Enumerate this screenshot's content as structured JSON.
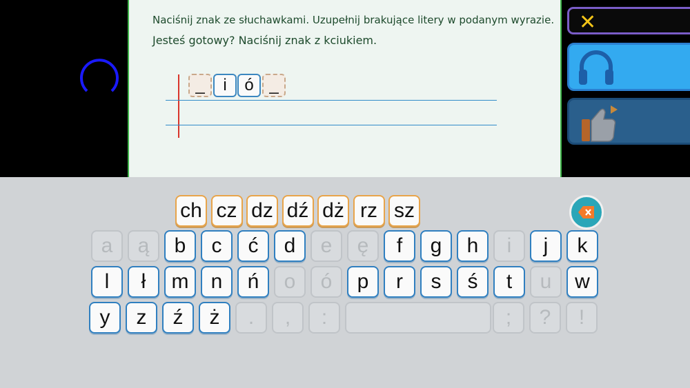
{
  "instructions": {
    "line1": "Naciśnij znak ze słuchawkami. Uzupełnij brakujące litery w podanym wyrazie.",
    "line2": "Jesteś gotowy? Naciśnij znak z kciukiem."
  },
  "word_slots": [
    {
      "value": "_",
      "state": "blank"
    },
    {
      "value": "i",
      "state": "filled"
    },
    {
      "value": "ó",
      "state": "filled"
    },
    {
      "value": "_",
      "state": "blank"
    }
  ],
  "side_buttons": {
    "close_icon": "close-icon",
    "audio_icon": "headphones-icon",
    "confirm_icon": "thumbs-up-icon"
  },
  "keyboard": {
    "digraphs": [
      "ch",
      "cz",
      "dz",
      "dź",
      "dż",
      "rz",
      "sz"
    ],
    "row1": [
      {
        "k": "a",
        "on": false
      },
      {
        "k": "ą",
        "on": false
      },
      {
        "k": "b",
        "on": true
      },
      {
        "k": "c",
        "on": true
      },
      {
        "k": "ć",
        "on": true
      },
      {
        "k": "d",
        "on": true
      },
      {
        "k": "e",
        "on": false
      },
      {
        "k": "ę",
        "on": false
      },
      {
        "k": "f",
        "on": true
      },
      {
        "k": "g",
        "on": true
      },
      {
        "k": "h",
        "on": true
      },
      {
        "k": "i",
        "on": false
      },
      {
        "k": "j",
        "on": true
      },
      {
        "k": "k",
        "on": true
      }
    ],
    "row2": [
      {
        "k": "l",
        "on": true
      },
      {
        "k": "ł",
        "on": true
      },
      {
        "k": "m",
        "on": true
      },
      {
        "k": "n",
        "on": true
      },
      {
        "k": "ń",
        "on": true
      },
      {
        "k": "o",
        "on": false
      },
      {
        "k": "ó",
        "on": false
      },
      {
        "k": "p",
        "on": true
      },
      {
        "k": "r",
        "on": true
      },
      {
        "k": "s",
        "on": true
      },
      {
        "k": "ś",
        "on": true
      },
      {
        "k": "t",
        "on": true
      },
      {
        "k": "u",
        "on": false
      },
      {
        "k": "w",
        "on": true
      }
    ],
    "row3": [
      {
        "k": "y",
        "on": true
      },
      {
        "k": "z",
        "on": true
      },
      {
        "k": "ź",
        "on": true
      },
      {
        "k": "ż",
        "on": true
      },
      {
        "k": ".",
        "on": false
      },
      {
        "k": ",",
        "on": false
      },
      {
        "k": ":",
        "on": false
      },
      {
        "k": "",
        "on": false,
        "space": true
      },
      {
        "k": ";",
        "on": false
      },
      {
        "k": "?",
        "on": false
      },
      {
        "k": "!",
        "on": false
      }
    ],
    "backspace_icon": "backspace-icon"
  },
  "colors": {
    "accent_green": "#3fb54a",
    "key_border": "#2f7fc0",
    "digraph_border": "#e8a44a",
    "audio_button": "#33aaf0",
    "confirm_button": "#2a5f8c"
  }
}
